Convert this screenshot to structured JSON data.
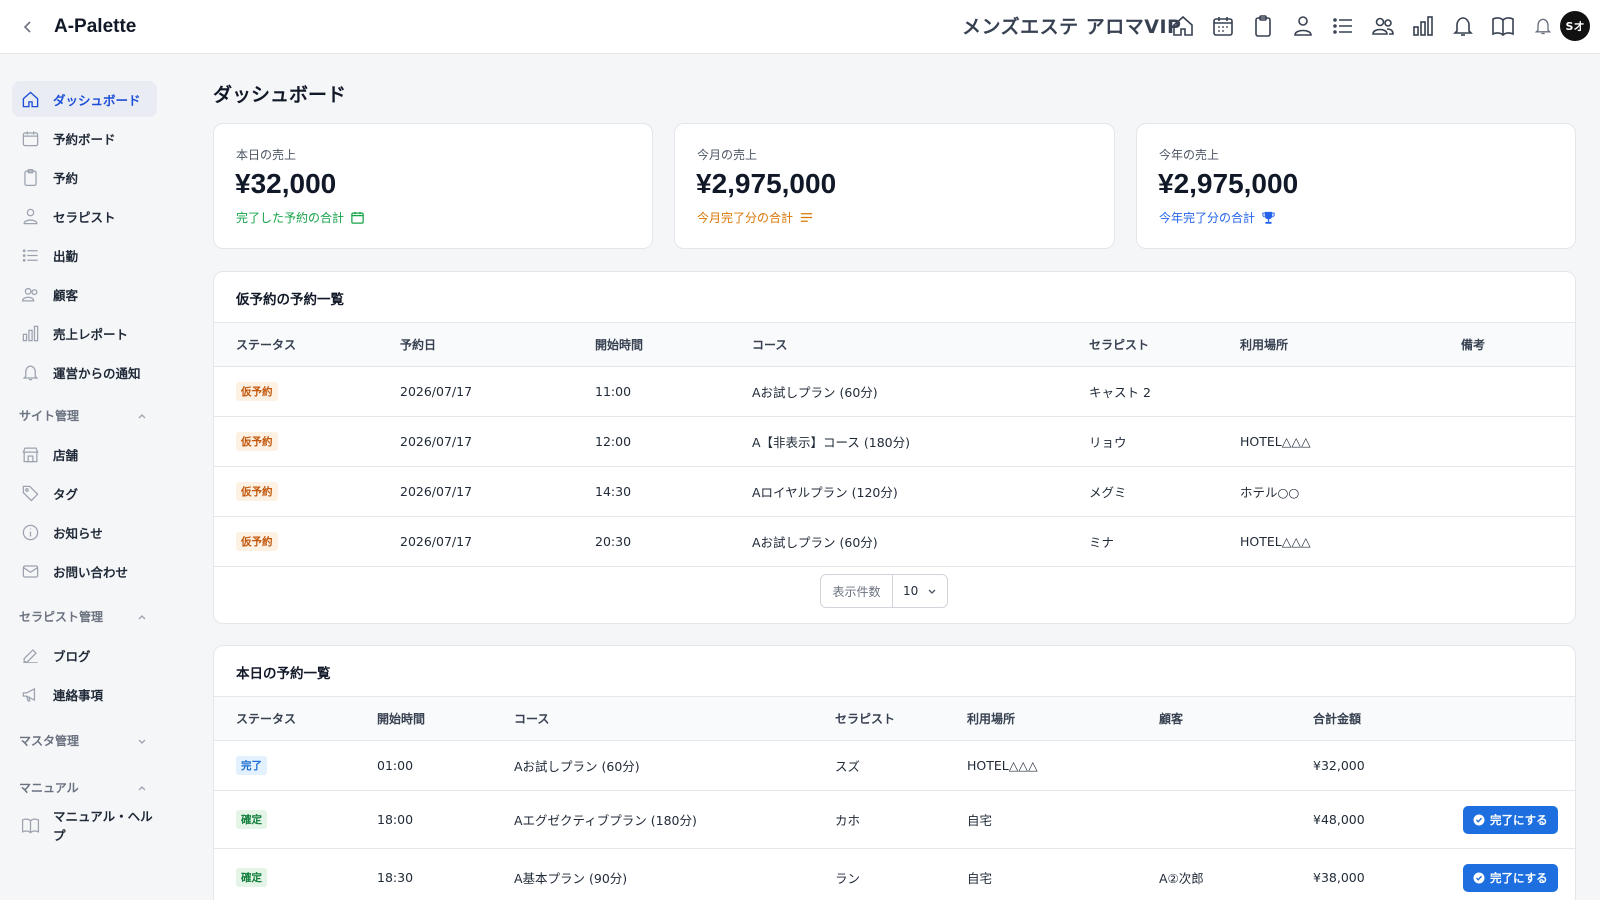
{
  "app": {
    "title": "A-Palette",
    "shop_name": "メンズエステ アロマVIP",
    "avatar_text": "Sオ"
  },
  "top_icons": [
    "home-icon",
    "calendar-icon",
    "clipboard-icon",
    "user-icon",
    "list-icon",
    "users-icon",
    "bar-chart-icon",
    "bell-icon",
    "book-icon",
    "bell-small-icon"
  ],
  "sidebar": {
    "items": [
      {
        "label": "ダッシュボード",
        "icon": "home-icon"
      },
      {
        "label": "予約ボード",
        "icon": "calendar-icon"
      },
      {
        "label": "予約",
        "icon": "clipboard-icon"
      },
      {
        "label": "セラピスト",
        "icon": "user-icon"
      },
      {
        "label": "出勤",
        "icon": "list-icon"
      },
      {
        "label": "顧客",
        "icon": "users-icon"
      },
      {
        "label": "売上レポート",
        "icon": "bar-chart-icon"
      },
      {
        "label": "運営からの通知",
        "icon": "bell-icon"
      }
    ],
    "site_section": {
      "label": "サイト管理",
      "items": [
        {
          "label": "店舗",
          "icon": "store-icon"
        },
        {
          "label": "タグ",
          "icon": "tag-icon"
        },
        {
          "label": "お知らせ",
          "icon": "info-icon"
        },
        {
          "label": "お問い合わせ",
          "icon": "mail-icon"
        }
      ]
    },
    "therapist_section": {
      "label": "セラピスト管理",
      "items": [
        {
          "label": "ブログ",
          "icon": "edit-icon"
        },
        {
          "label": "連絡事項",
          "icon": "megaphone-icon"
        }
      ]
    },
    "master_section": {
      "label": "マスタ管理"
    },
    "manual_section": {
      "label": "マニュアル",
      "items": [
        {
          "label": "マニュアル・ヘルプ",
          "icon": "book-icon"
        }
      ]
    }
  },
  "page": {
    "title": "ダッシュボード"
  },
  "stats": [
    {
      "label": "本日の売上",
      "value": "¥32,000",
      "note": "完了した予約の合計",
      "color": "#16a34a",
      "icon": "calendar-icon"
    },
    {
      "label": "今月の売上",
      "value": "¥2,975,000",
      "note": "今月完了分の合計",
      "color": "#d97706",
      "icon": "lines-icon"
    },
    {
      "label": "今年の売上",
      "value": "¥2,975,000",
      "note": "今年完了分の合計",
      "color": "#2563eb",
      "icon": "trophy-icon"
    }
  ],
  "tentative": {
    "title": "仮予約の予約一覧",
    "headers": [
      "ステータス",
      "予約日",
      "開始時間",
      "コース",
      "セラピスト",
      "利用場所",
      "備考"
    ],
    "rows": [
      {
        "status": "仮予約",
        "date": "2026/07/17",
        "time": "11:00",
        "course": "Aお試しプラン (60分)",
        "therapist": "キャスト 2",
        "place": "",
        "note": ""
      },
      {
        "status": "仮予約",
        "date": "2026/07/17",
        "time": "12:00",
        "course": "A【非表示】コース (180分)",
        "therapist": "リョウ",
        "place": "HOTEL△△△",
        "note": ""
      },
      {
        "status": "仮予約",
        "date": "2026/07/17",
        "time": "14:30",
        "course": "Aロイヤルプラン (120分)",
        "therapist": "メグミ",
        "place": "ホテル○○",
        "note": ""
      },
      {
        "status": "仮予約",
        "date": "2026/07/17",
        "time": "20:30",
        "course": "Aお試しプラン (60分)",
        "therapist": "ミナ",
        "place": "HOTEL△△△",
        "note": ""
      }
    ],
    "pager_label": "表示件数",
    "pager_value": "10"
  },
  "today": {
    "title": "本日の予約一覧",
    "headers": [
      "ステータス",
      "開始時間",
      "コース",
      "セラピスト",
      "利用場所",
      "顧客",
      "合計金額"
    ],
    "rows": [
      {
        "status": "完了",
        "badge": "done",
        "time": "01:00",
        "course": "Aお試しプラン (60分)",
        "therapist": "スズ",
        "place": "HOTEL△△△",
        "customer": "",
        "amount": "¥32,000",
        "action": ""
      },
      {
        "status": "確定",
        "badge": "confirmed",
        "time": "18:00",
        "course": "Aエグゼクティブプラン (180分)",
        "therapist": "カホ",
        "place": "自宅",
        "customer": "",
        "amount": "¥48,000",
        "action": "完了にする"
      },
      {
        "status": "確定",
        "badge": "confirmed",
        "time": "18:30",
        "course": "A基本プラン (90分)",
        "therapist": "ラン",
        "place": "自宅",
        "customer": "A②次郎",
        "amount": "¥38,000",
        "action": "完了にする"
      }
    ]
  }
}
